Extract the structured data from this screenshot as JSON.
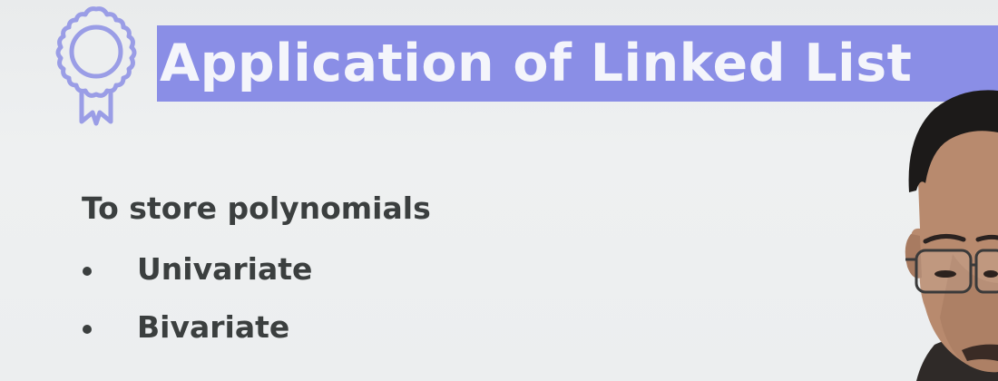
{
  "slide": {
    "title": "Application of Linked List",
    "intro": "To store polynomials",
    "bullets": [
      {
        "label": "Univariate"
      },
      {
        "label": "Bivariate"
      }
    ]
  },
  "icons": {
    "header_icon": "award-ribbon-icon",
    "bullet_icon": "bullet-dot-icon"
  },
  "colors": {
    "title_highlight": "#8a8ee6",
    "title_text": "#f4f5fb",
    "body_text": "#3b3f3f",
    "icon_stroke": "#9a9de6",
    "background": "#eceeef"
  }
}
